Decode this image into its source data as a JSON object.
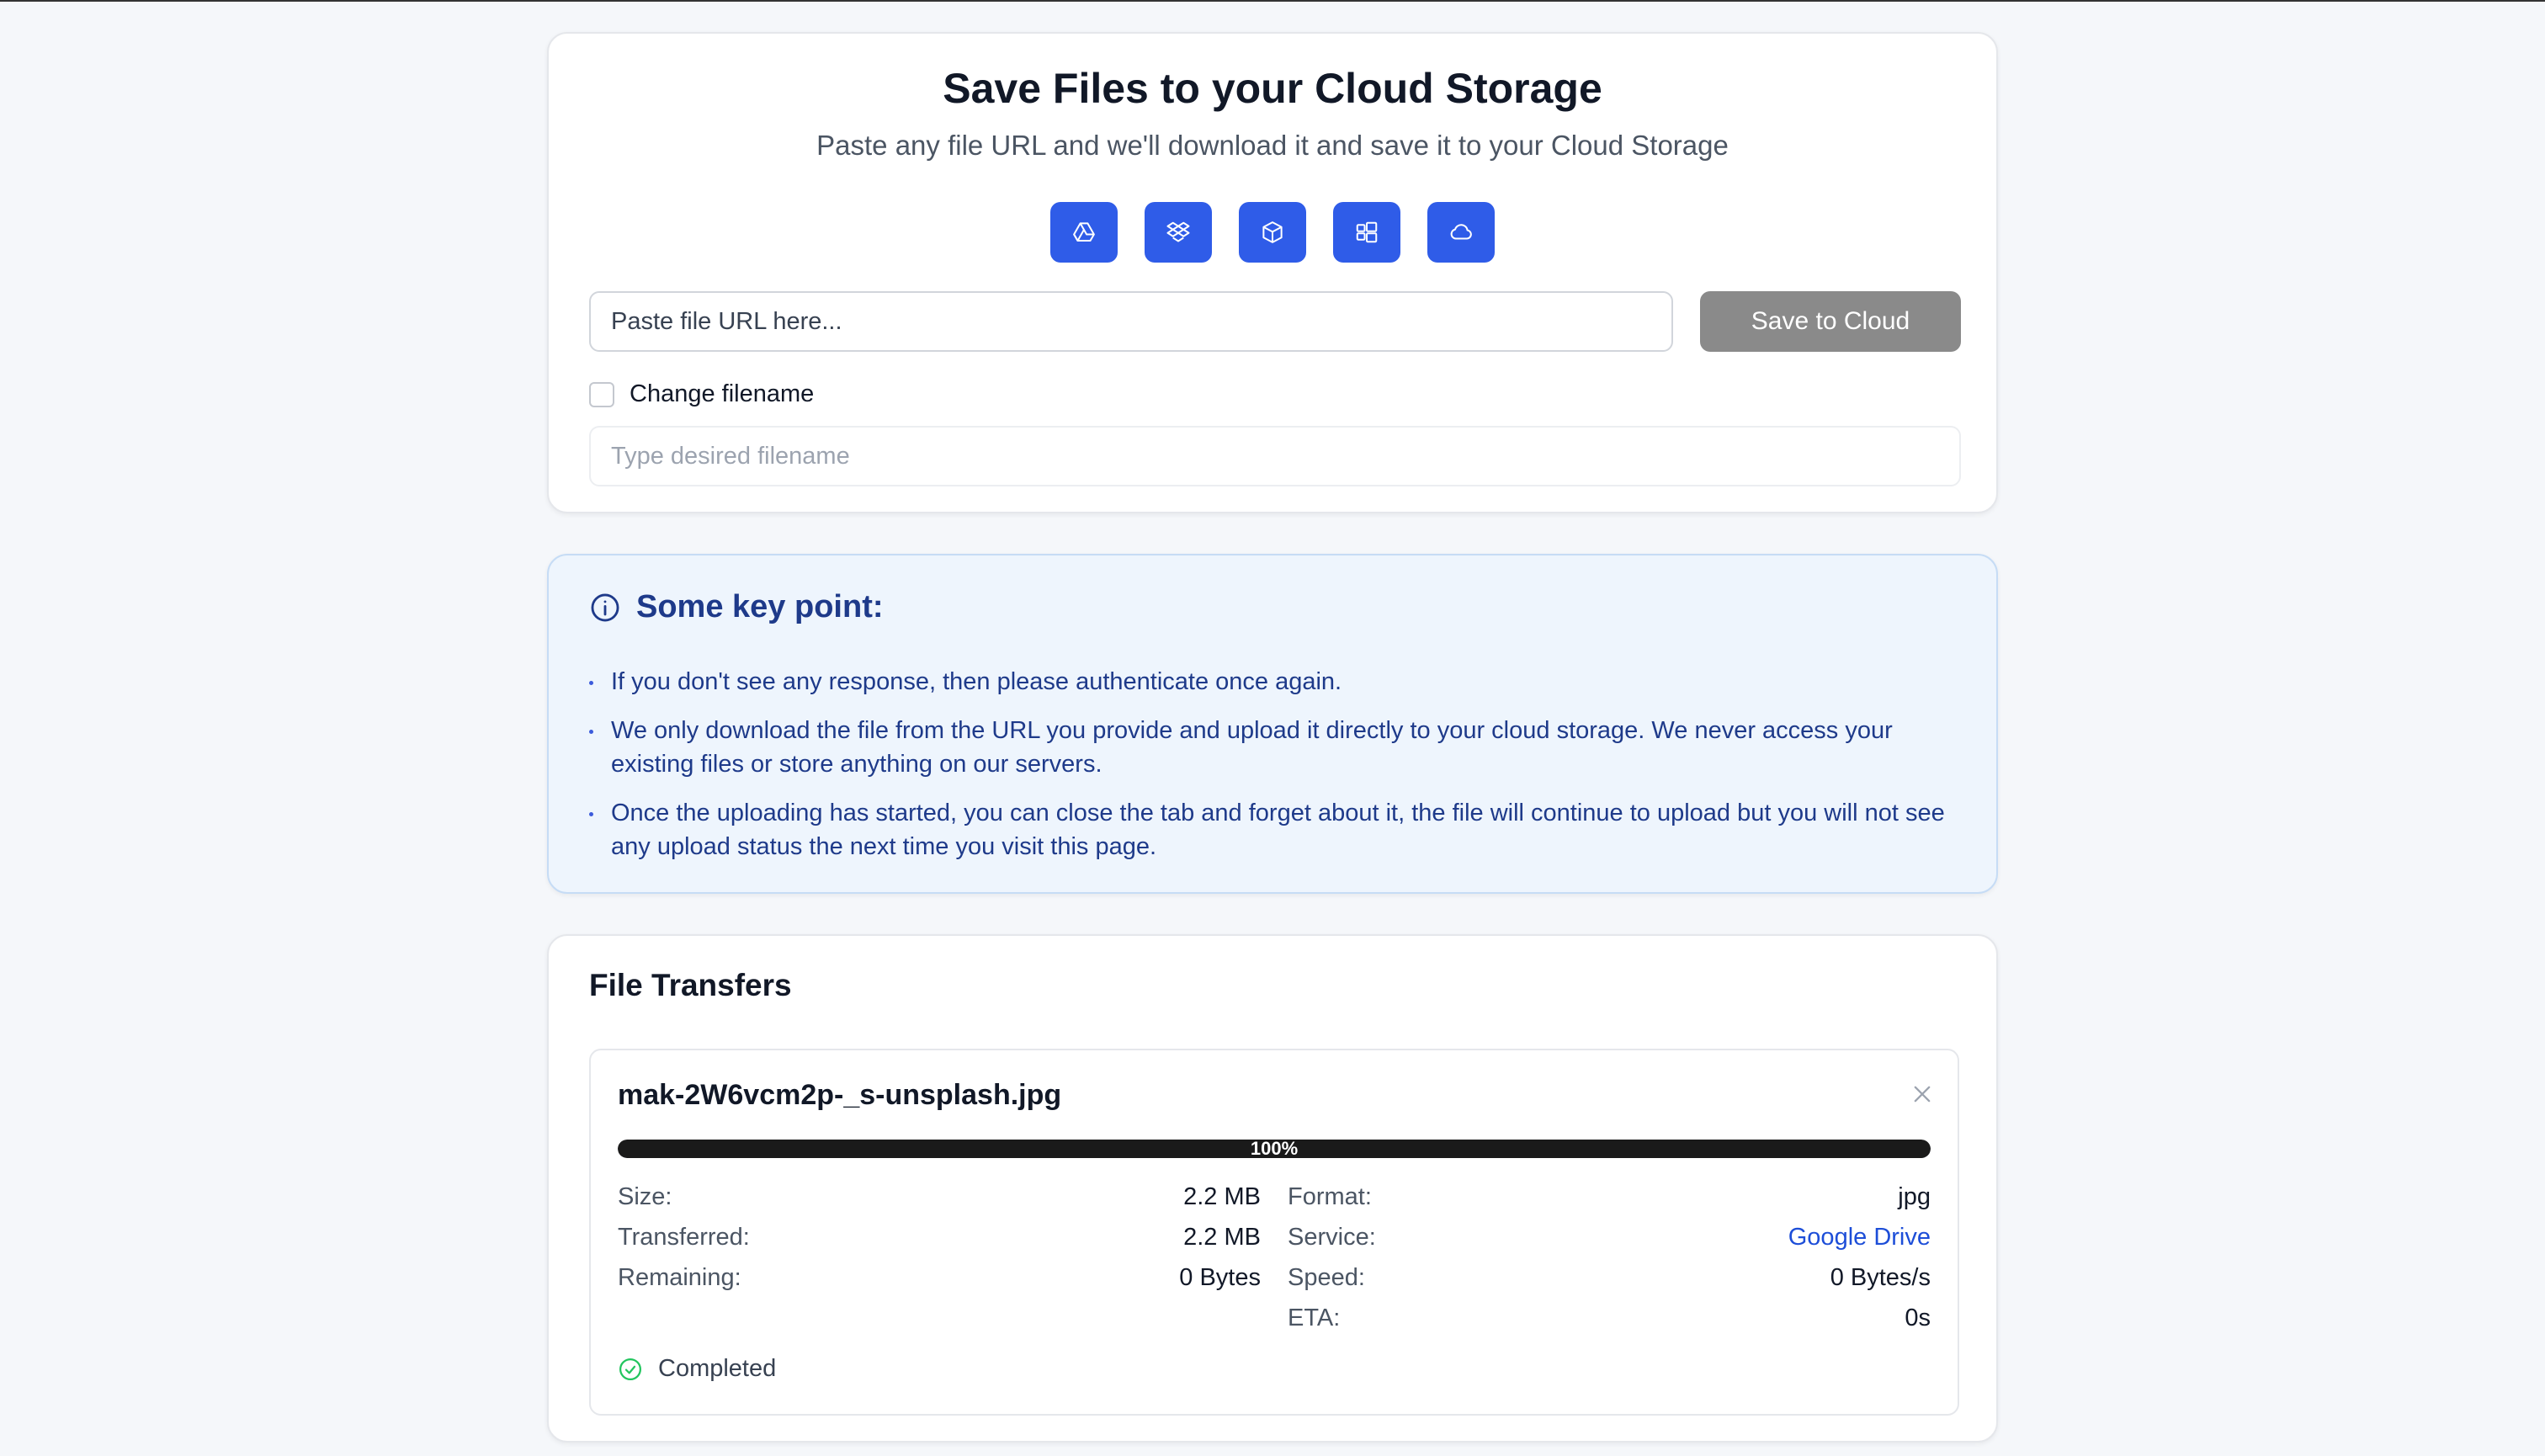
{
  "save_card": {
    "title": "Save Files to your Cloud Storage",
    "subtitle": "Paste any file URL and we'll download it and save it to your Cloud Storage",
    "services": [
      "google-drive-icon",
      "dropbox-icon",
      "box-icon",
      "onedrive-icon",
      "cloud-icon"
    ],
    "url_placeholder": "Paste file URL here...",
    "save_button": "Save to Cloud",
    "change_filename_label": "Change filename",
    "filename_placeholder": "Type desired filename"
  },
  "info_card": {
    "title": "Some key point:",
    "points": [
      "If you don't see any response, then please authenticate once again.",
      "We only download the file from the URL you provide and upload it directly to your cloud storage. We never access your existing files or store anything on our servers.",
      "Once the uploading has started, you can close the tab and forget about it, the file will continue to upload but you will not see any upload status the next time you visit this page."
    ]
  },
  "transfers": {
    "title": "File Transfers",
    "items": [
      {
        "filename": "mak-2W6vcm2p-_s-unsplash.jpg",
        "progress_percent": 100,
        "progress_text": "100%",
        "left": [
          {
            "label": "Size:",
            "value": "2.2 MB"
          },
          {
            "label": "Transferred:",
            "value": "2.2 MB"
          },
          {
            "label": "Remaining:",
            "value": "0 Bytes"
          }
        ],
        "right": [
          {
            "label": "Format:",
            "value": "jpg"
          },
          {
            "label": "Service:",
            "value": "Google Drive"
          },
          {
            "label": "Speed:",
            "value": "0 Bytes/s"
          },
          {
            "label": "ETA:",
            "value": "0s"
          }
        ],
        "status": "Completed"
      }
    ]
  },
  "colors": {
    "accent": "#2f5ce8",
    "info_bg": "#eef5fd",
    "info_text": "#1e3a8a",
    "success": "#22c55e",
    "link": "#1d4ed8"
  }
}
